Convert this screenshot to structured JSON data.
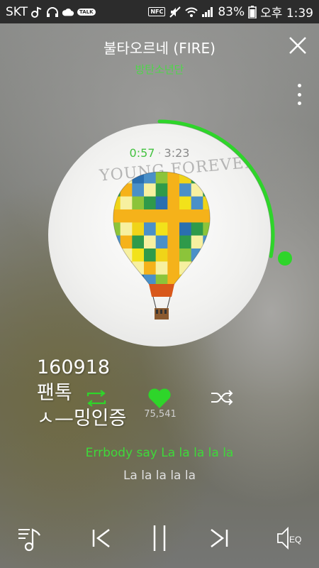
{
  "status_bar": {
    "carrier": "SKT",
    "battery": "83%",
    "time": "오후 1:39",
    "nfc_label": "NFC",
    "talk_label": "TALK"
  },
  "player": {
    "song_title": "불타오르네 (FIRE)",
    "artist": "방탄소년단",
    "time_current": "0:57",
    "time_separator": "·",
    "time_total": "3:23",
    "progress_fraction": 0.28,
    "album_watermark": "YOUNG FOREVER",
    "like_count": "75,541",
    "lyric_current": "Errbody say La la la la la",
    "lyric_next": "La la la la la",
    "eq_label": "EQ"
  },
  "overlay_note": {
    "line1": "160918",
    "line2": "팬톡",
    "line3": "ㅅ—밍인증"
  },
  "colors": {
    "accent_green": "#2ed52a",
    "lyric_green": "#3ed93a",
    "status_bar_bg": "#2c2c2c"
  },
  "icons": {
    "close": "close-icon",
    "more": "more-vertical-icon",
    "repeat": "repeat-icon",
    "like": "heart-icon",
    "shuffle": "shuffle-icon",
    "playlist": "playlist-icon",
    "prev": "skip-previous-icon",
    "pause": "pause-icon",
    "next": "skip-next-icon",
    "eq": "equalizer-icon"
  }
}
